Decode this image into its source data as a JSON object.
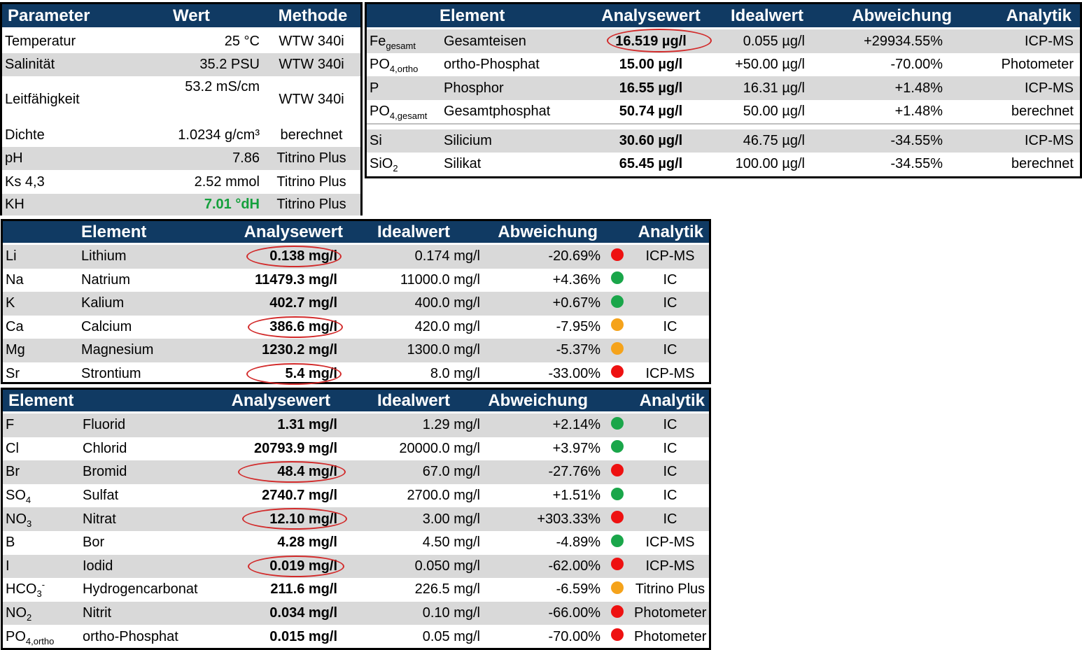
{
  "params": {
    "headers": {
      "parameter": "Parameter",
      "wert": "Wert",
      "methode": "Methode"
    },
    "rows": [
      {
        "name": "Temperatur",
        "value": "25 °C",
        "method": "WTW 340i"
      },
      {
        "name": "Salinität",
        "value": "35.2 PSU",
        "method": "WTW 340i"
      },
      {
        "name": "Leitfähigkeit",
        "value": "53.2 mS/cm",
        "method": "WTW 340i"
      },
      {
        "name": "Dichte",
        "value": "1.0234 g/cm³",
        "method": "berechnet"
      },
      {
        "name": "pH",
        "value": "7.86",
        "method": "Titrino Plus"
      },
      {
        "name": "Ks 4,3",
        "value": "2.52 mmol",
        "method": "Titrino Plus"
      },
      {
        "name": "KH",
        "value": "7.01 °dH",
        "method": "Titrino Plus"
      }
    ]
  },
  "trace": {
    "headers": {
      "element": "Element",
      "analysewert": "Analysewert",
      "idealwert": "Idealwert",
      "abweichung": "Abweichung",
      "analytik": "Analytik"
    },
    "rows": [
      {
        "sym": "Fe",
        "sub": "gesamt",
        "name": "Gesamteisen",
        "value": "16.519 µg/l",
        "ideal": "0.055 µg/l",
        "dev": "+29934.55%",
        "method": "ICP-MS"
      },
      {
        "sym": "PO",
        "sub": "4,ortho",
        "name": "ortho-Phosphat",
        "value": "15.00 µg/l",
        "ideal": "+50.00 µg/l",
        "dev": "-70.00%",
        "method": "Photometer"
      },
      {
        "sym": "P",
        "sub": "",
        "name": "Phosphor",
        "value": "16.55 µg/l",
        "ideal": "16.31 µg/l",
        "dev": "+1.48%",
        "method": "ICP-MS"
      },
      {
        "sym": "PO",
        "sub": "4,gesamt",
        "name": "Gesamtphosphat",
        "value": "50.74 µg/l",
        "ideal": "50.00 µg/l",
        "dev": "+1.48%",
        "method": "berechnet"
      },
      {
        "sym": "Si",
        "sub": "",
        "name": "Silicium",
        "value": "30.60 µg/l",
        "ideal": "46.75 µg/l",
        "dev": "-34.55%",
        "method": "ICP-MS"
      },
      {
        "sym": "SiO",
        "sub": "2",
        "name": "Silikat",
        "value": "65.45 µg/l",
        "ideal": "100.00 µg/l",
        "dev": "-34.55%",
        "method": "berechnet"
      }
    ]
  },
  "cations": {
    "headers": {
      "element": "Element",
      "analysewert": "Analysewert",
      "idealwert": "Idealwert",
      "abweichung": "Abweichung",
      "analytik": "Analytik"
    },
    "rows": [
      {
        "sym": "Li",
        "name": "Lithium",
        "value": "0.138 mg/l",
        "ideal": "0.174 mg/l",
        "dev": "-20.69%",
        "status": "#ee1111",
        "method": "ICP-MS"
      },
      {
        "sym": "Na",
        "name": "Natrium",
        "value": "11479.3 mg/l",
        "ideal": "11000.0 mg/l",
        "dev": "+4.36%",
        "status": "#1aa64a",
        "method": "IC"
      },
      {
        "sym": "K",
        "name": "Kalium",
        "value": "402.7 mg/l",
        "ideal": "400.0 mg/l",
        "dev": "+0.67%",
        "status": "#1aa64a",
        "method": "IC"
      },
      {
        "sym": "Ca",
        "name": "Calcium",
        "value": "386.6 mg/l",
        "ideal": "420.0 mg/l",
        "dev": "-7.95%",
        "status": "#f5a31b",
        "method": "IC"
      },
      {
        "sym": "Mg",
        "name": "Magnesium",
        "value": "1230.2 mg/l",
        "ideal": "1300.0 mg/l",
        "dev": "-5.37%",
        "status": "#f5a31b",
        "method": "IC"
      },
      {
        "sym": "Sr",
        "name": "Strontium",
        "value": "5.4 mg/l",
        "ideal": "8.0 mg/l",
        "dev": "-33.00%",
        "status": "#ee1111",
        "method": "ICP-MS"
      }
    ]
  },
  "anions": {
    "headers": {
      "element": "Element",
      "analysewert": "Analysewert",
      "idealwert": "Idealwert",
      "abweichung": "Abweichung",
      "analytik": "Analytik"
    },
    "rows": [
      {
        "sym": "F",
        "sub": "",
        "sup": "",
        "name": "Fluorid",
        "value": "1.31 mg/l",
        "ideal": "1.29 mg/l",
        "dev": "+2.14%",
        "status": "#1aa64a",
        "method": "IC"
      },
      {
        "sym": "Cl",
        "sub": "",
        "sup": "",
        "name": "Chlorid",
        "value": "20793.9 mg/l",
        "ideal": "20000.0 mg/l",
        "dev": "+3.97%",
        "status": "#1aa64a",
        "method": "IC"
      },
      {
        "sym": "Br",
        "sub": "",
        "sup": "",
        "name": "Bromid",
        "value": "48.4 mg/l",
        "ideal": "67.0 mg/l",
        "dev": "-27.76%",
        "status": "#ee1111",
        "method": "IC"
      },
      {
        "sym": "SO",
        "sub": "4",
        "sup": "",
        "name": "Sulfat",
        "value": "2740.7 mg/l",
        "ideal": "2700.0 mg/l",
        "dev": "+1.51%",
        "status": "#1aa64a",
        "method": "IC"
      },
      {
        "sym": "NO",
        "sub": "3",
        "sup": "",
        "name": "Nitrat",
        "value": "12.10 mg/l",
        "ideal": "3.00 mg/l",
        "dev": "+303.33%",
        "status": "#ee1111",
        "method": "IC"
      },
      {
        "sym": "B",
        "sub": "",
        "sup": "",
        "name": "Bor",
        "value": "4.28 mg/l",
        "ideal": "4.50 mg/l",
        "dev": "-4.89%",
        "status": "#1aa64a",
        "method": "ICP-MS"
      },
      {
        "sym": "I",
        "sub": "",
        "sup": "",
        "name": "Iodid",
        "value": "0.019 mg/l",
        "ideal": "0.050 mg/l",
        "dev": "-62.00%",
        "status": "#ee1111",
        "method": "ICP-MS"
      },
      {
        "sym": "HCO",
        "sub": "3",
        "sup": "-",
        "name": "Hydrogencarbonat",
        "value": "211.6 mg/l",
        "ideal": "226.5 mg/l",
        "dev": "-6.59%",
        "status": "#f5a31b",
        "method": "Titrino Plus"
      },
      {
        "sym": "NO",
        "sub": "2",
        "sup": "",
        "name": "Nitrit",
        "value": "0.034 mg/l",
        "ideal": "0.10 mg/l",
        "dev": "-66.00%",
        "status": "#ee1111",
        "method": "Photometer"
      },
      {
        "sym": "PO",
        "sub": "4,ortho",
        "sup": "",
        "name": "ortho-Phosphat",
        "value": "0.015 mg/l",
        "ideal": "0.05 mg/l",
        "dev": "-70.00%",
        "status": "#ee1111",
        "method": "Photometer"
      }
    ]
  }
}
